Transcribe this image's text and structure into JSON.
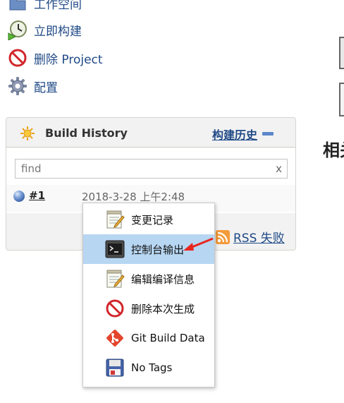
{
  "tasks": [
    {
      "label": "工作空间",
      "icon": "folder-icon"
    },
    {
      "label": "立即构建",
      "icon": "clock-run-icon"
    },
    {
      "label": "删除 Project",
      "icon": "no-entry-icon"
    },
    {
      "label": "配置",
      "icon": "gear-icon"
    }
  ],
  "build_history": {
    "title": "Build History",
    "trend_label": "构建历史",
    "search_placeholder": "find",
    "clear_label": "x",
    "builds": [
      {
        "number": "#1",
        "date": "2018-3-28 上午2:48",
        "status_icon": "blue-ball-icon"
      }
    ],
    "rss_label": "RSS 失败"
  },
  "right_fragment_text": "相关",
  "context_menu": {
    "items": [
      {
        "label": "变更记录",
        "icon": "notepad-icon",
        "selected": false
      },
      {
        "label": "控制台输出",
        "icon": "terminal-icon",
        "selected": true
      },
      {
        "label": "编辑编译信息",
        "icon": "notepad-icon",
        "selected": false
      },
      {
        "label": "删除本次生成",
        "icon": "no-entry-icon",
        "selected": false
      },
      {
        "label": "Git Build Data",
        "icon": "git-icon",
        "selected": false
      },
      {
        "label": "No Tags",
        "icon": "save-icon",
        "selected": false
      }
    ]
  },
  "colors": {
    "link": "#204a87",
    "menu_selected": "#b7d6f2",
    "annotation_arrow": "#e8261e",
    "rss": "#f39a3b"
  }
}
